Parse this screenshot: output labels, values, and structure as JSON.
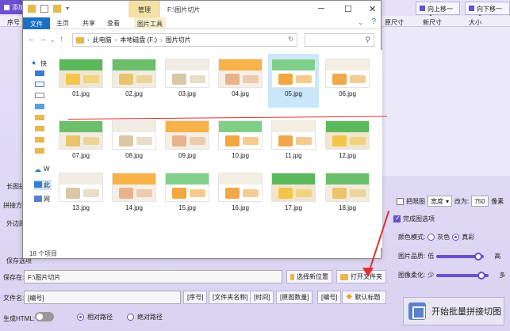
{
  "app": {
    "title": "添加",
    "col_head": "序号",
    "btn_up": "向上移一个",
    "btn_down": "向下移一个",
    "table_cols": [
      "原尺寸",
      "新尺寸",
      "大小"
    ],
    "side": {
      "section": "长图拼",
      "direction": "拼接方向",
      "margin": "外边距",
      "save_section": "保存选项"
    }
  },
  "right": {
    "lock_label": "把限图",
    "width_sel": "宽度",
    "change_label": "改为:",
    "width_value": "750",
    "unit": "像素",
    "finish_label": "完成图选项",
    "color_mode_label": "颜色模式:",
    "gray": "灰色",
    "color": "真彩",
    "quality_label": "图片品质:",
    "quality_low": "低",
    "quality_high": "高",
    "quality_level": 0.88,
    "soften_label": "图像柔化:",
    "soften_low": "少",
    "soften_high": "多",
    "soften_level": 0.86,
    "start_btn": "开始批量拼接切图"
  },
  "save": {
    "save_label": "保存在:",
    "save_path": "F:\\图片切片",
    "choose_btn": "选择新位置",
    "open_btn": "打开文件夹",
    "filename_label": "文件名:",
    "filename_value": "[编号]",
    "tags": [
      "[序号]",
      "[文件夹名称]",
      "[时间]",
      "[原图数量]",
      "[编号]"
    ],
    "default_btn": "默认标题",
    "gen_html": "生成HTML:",
    "relative": "相对路径",
    "absolute": "绝对路径"
  },
  "explorer": {
    "title": "F:\\图片切片",
    "manage": "管理",
    "tabs": [
      "文件",
      "主页",
      "共享",
      "查看",
      "图片工具"
    ],
    "breadcrumb": [
      "此电脑",
      "本地磁盘 (F:)",
      "图片切片"
    ],
    "search_placeholder": "",
    "status": "18 个项目",
    "nav_items": [
      "快",
      "W",
      "此",
      "网"
    ],
    "files": [
      "01.jpg",
      "02.jpg",
      "03.jpg",
      "04.jpg",
      "05.jpg",
      "06.jpg",
      "07.jpg",
      "08.jpg",
      "09.jpg",
      "10.jpg",
      "11.jpg",
      "12.jpg",
      "13.jpg",
      "14.jpg",
      "15.jpg",
      "16.jpg",
      "17.jpg",
      "18.jpg"
    ],
    "selected": "05.jpg"
  },
  "colors": {
    "accent": "#6a4fcf",
    "explorer_blue": "#1a6fc4",
    "annotation_red": "#e53030"
  }
}
